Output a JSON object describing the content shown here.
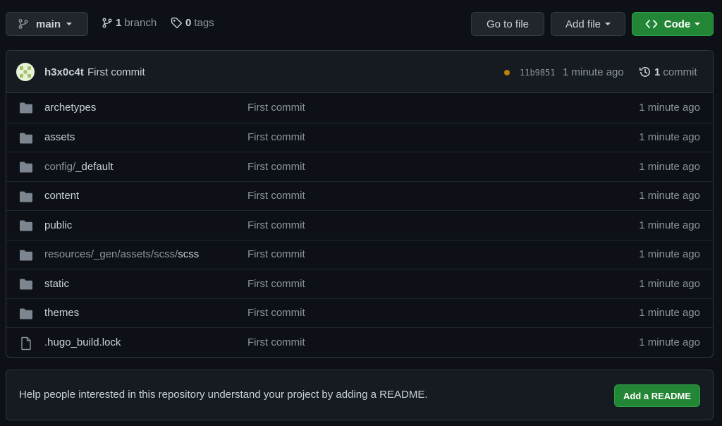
{
  "toolbar": {
    "branch_button_label": "main",
    "branches_count": "1",
    "branches_label": "branch",
    "tags_count": "0",
    "tags_label": "tags",
    "go_to_file_label": "Go to file",
    "add_file_label": "Add file",
    "code_label": "Code"
  },
  "commit_header": {
    "author": "h3x0c4t",
    "message": "First commit",
    "sha": "11b9851",
    "time": "1 minute ago",
    "commits_count": "1",
    "commits_label": "commit",
    "status_color": "#bb8009"
  },
  "files": [
    {
      "type": "dir",
      "prefix": "",
      "name": "archetypes",
      "message": "First commit",
      "age": "1 minute ago"
    },
    {
      "type": "dir",
      "prefix": "",
      "name": "assets",
      "message": "First commit",
      "age": "1 minute ago"
    },
    {
      "type": "dir",
      "prefix": "config/",
      "name": "_default",
      "message": "First commit",
      "age": "1 minute ago"
    },
    {
      "type": "dir",
      "prefix": "",
      "name": "content",
      "message": "First commit",
      "age": "1 minute ago"
    },
    {
      "type": "dir",
      "prefix": "",
      "name": "public",
      "message": "First commit",
      "age": "1 minute ago"
    },
    {
      "type": "dir",
      "prefix": "resources/_gen/assets/scss/",
      "name": "scss",
      "message": "First commit",
      "age": "1 minute ago"
    },
    {
      "type": "dir",
      "prefix": "",
      "name": "static",
      "message": "First commit",
      "age": "1 minute ago"
    },
    {
      "type": "dir",
      "prefix": "",
      "name": "themes",
      "message": "First commit",
      "age": "1 minute ago"
    },
    {
      "type": "file",
      "prefix": "",
      "name": ".hugo_build.lock",
      "message": "First commit",
      "age": "1 minute ago"
    }
  ],
  "readme_banner": {
    "text": "Help people interested in this repository understand your project by adding a README.",
    "button_label": "Add a README"
  },
  "colors": {
    "background": "#0d1117",
    "panel": "#161b22",
    "border": "#30363d",
    "green": "#238636",
    "folder_icon": "#7d8590"
  },
  "icons": {
    "branch_button": "git-branch-icon",
    "branches": "git-branch-icon",
    "tags": "tag-icon",
    "code": "code-icon",
    "history": "history-icon",
    "dir": "folder-icon",
    "file": "file-icon",
    "avatar": "identicon-avatar"
  }
}
